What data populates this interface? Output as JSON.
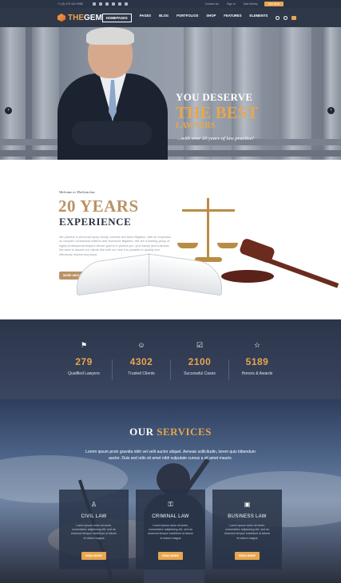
{
  "topbar": {
    "phone": "+1 (0) 475 424 9988",
    "links": [
      "Contact Us",
      "Sign In",
      "Add Money"
    ],
    "join": "Join Now"
  },
  "nav": {
    "brand_prefix": "THE",
    "brand": "GEM",
    "items": [
      "HOMEPAGES",
      "PAGES",
      "BLOG",
      "PORTFOLIOS",
      "SHOP",
      "FEATURES",
      "ELEMENTS"
    ],
    "cart_count": "1"
  },
  "hero": {
    "line1": "YOU DESERVE",
    "line2": "THE BEST",
    "line3": "LAWYERS",
    "line4": "...with over 20 years of law practice!",
    "prev": "‹",
    "next": "›"
  },
  "about": {
    "welcome": "Welcome to TheGem law",
    "years": "20 YEARS",
    "experience": "EXPERIENCE",
    "paragraph": "We practice in personal injury, family, criminal and labor litigation, with an emphasis on complex contractual matters and insurance litigation. We are a leading group of highly professional lawyers whose goal is to protect you, your family and business. We want to assure our clients that with our help it is possible to quickly and effectively resolve any issue.",
    "button": "MORE ABOUT US"
  },
  "stats": [
    {
      "icon": "flag-icon",
      "glyph": "⚑",
      "value": "279",
      "label": "Qualified Lawyers"
    },
    {
      "icon": "users-icon",
      "glyph": "☺",
      "value": "4302",
      "label": "Trusted Clients"
    },
    {
      "icon": "check-box-icon",
      "glyph": "☑",
      "value": "2100",
      "label": "Successful Cases"
    },
    {
      "icon": "star-icon",
      "glyph": "☆",
      "value": "5189",
      "label": "Honors & Awards"
    }
  ],
  "services": {
    "title_a": "OUR",
    "title_b": "SERVICES",
    "text": "Lorem ipsum proin gravida nibh vel velit auctor aliquet. Aenean sollicitudin, lorem quis bibendum auctor. Duis sed odio sit amet nibh vulputate cursus a sit amet mauris.",
    "cards": [
      {
        "glyph": "♙",
        "title": "CIVIL LAW",
        "desc": "Lorem ipsum dolor sit amet, consectetur adipisicing elit, sed do eiusmod tempor incididunt ut labore et dolore magna",
        "button": "READ MORE"
      },
      {
        "glyph": "⚿",
        "title": "CRIMINAL LAW",
        "desc": "Lorem ipsum dolor sit amet, consectetur adipisicing elit, sed do eiusmod tempor incididunt ut labore et dolore magna",
        "button": "READ MORE"
      },
      {
        "glyph": "▣",
        "title": "BUSINESS LAW",
        "desc": "Lorem ipsum dolor sit amet, consectetur adipisicing elit, sed do eiusmod tempor incididunt ut labore et dolore magna",
        "button": "READ MORE"
      }
    ]
  },
  "colors": {
    "accent": "#e8a64d",
    "gold": "#b99365",
    "navy": "#2f3849"
  }
}
